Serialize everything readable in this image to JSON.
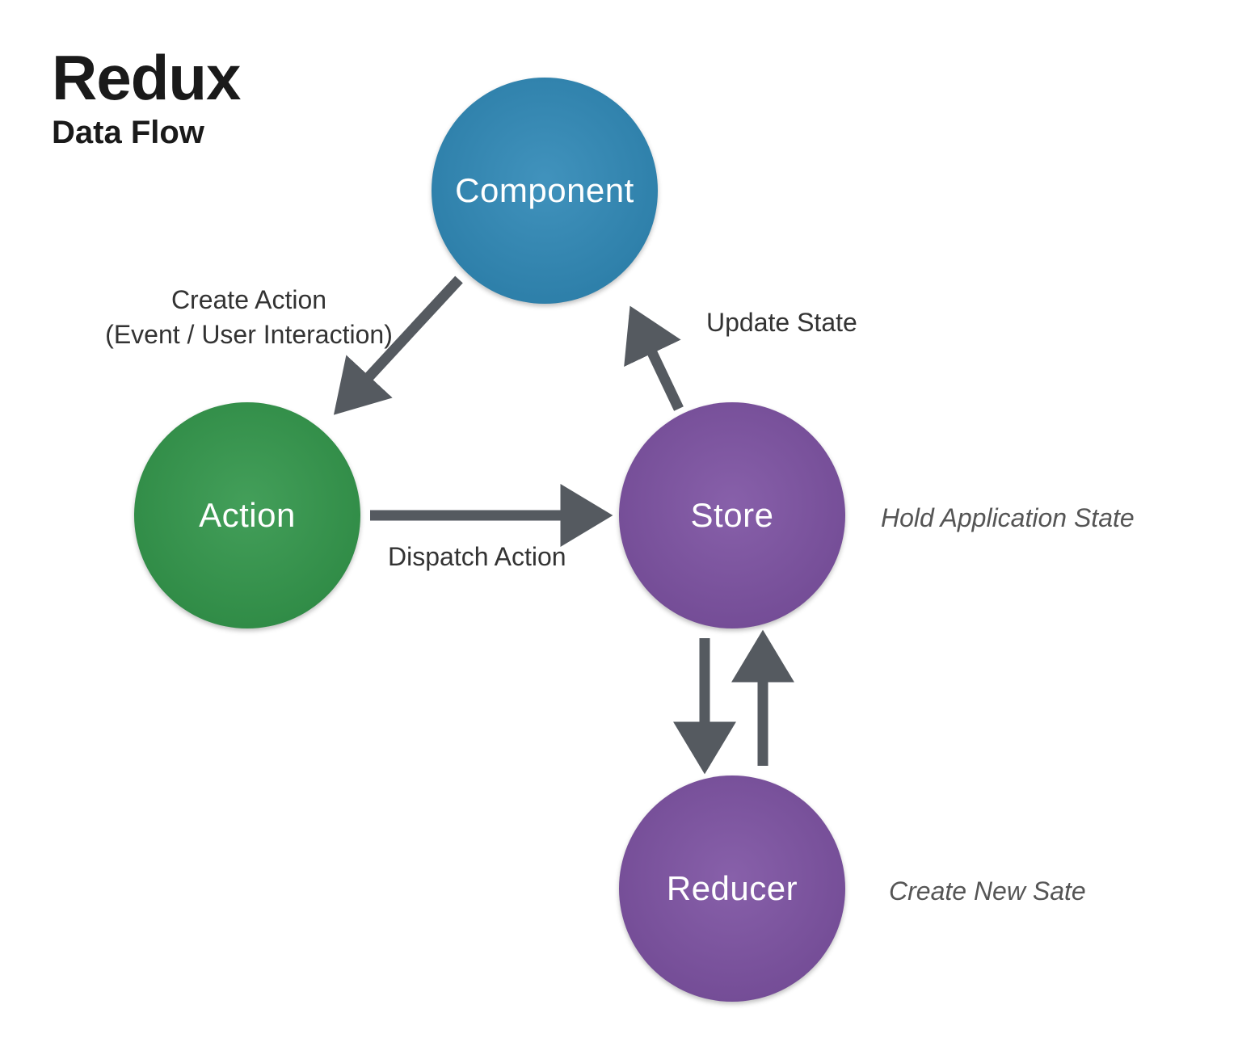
{
  "title": {
    "main": "Redux",
    "sub": "Data Flow"
  },
  "nodes": {
    "component": {
      "label": "Component",
      "color": "#2b86b5"
    },
    "action": {
      "label": "Action",
      "color": "#2e9447"
    },
    "store": {
      "label": "Store",
      "color": "#7a4ea0"
    },
    "reducer": {
      "label": "Reducer",
      "color": "#7a4ea0"
    }
  },
  "edges": {
    "create_action_l1": "Create Action",
    "create_action_l2": "(Event / User Interaction)",
    "dispatch_action": "Dispatch Action",
    "update_state": "Update State",
    "store_note": "Hold Application State",
    "reducer_note": "Create New Sate"
  },
  "arrow_color": "#555a60"
}
